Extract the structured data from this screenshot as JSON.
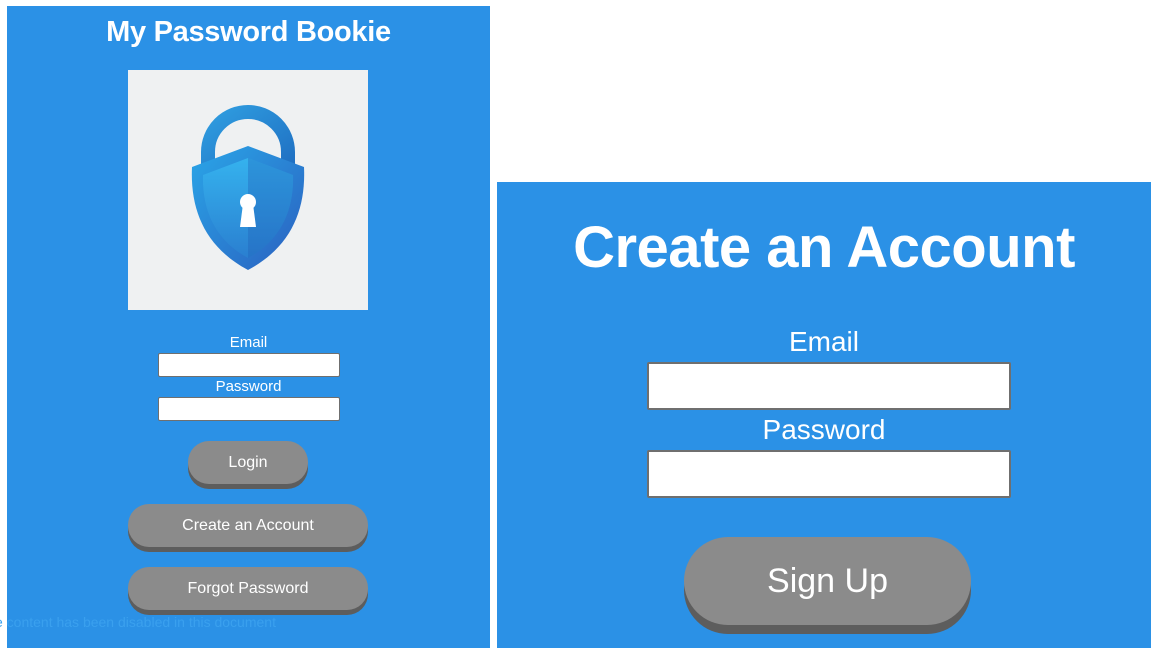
{
  "login_screen": {
    "title": "My Password Bookie",
    "email_label": "Email",
    "email_value": "",
    "password_label": "Password",
    "password_value": "",
    "login_button": "Login",
    "create_account_button": "Create an Account",
    "forgot_password_button": "Forgot Password",
    "disabled_note": "e content has been disabled in this document"
  },
  "signup_screen": {
    "title": "Create an Account",
    "email_label": "Email",
    "email_value": "",
    "password_label": "Password",
    "password_value": "",
    "signup_button": "Sign Up"
  },
  "colors": {
    "background": "#2b91e6",
    "button": "#8b8b8b",
    "button_shadow": "#5d5d5d",
    "logo_background": "#eff1f2"
  },
  "icons": {
    "logo": "padlock-shield-keyhole-icon"
  }
}
